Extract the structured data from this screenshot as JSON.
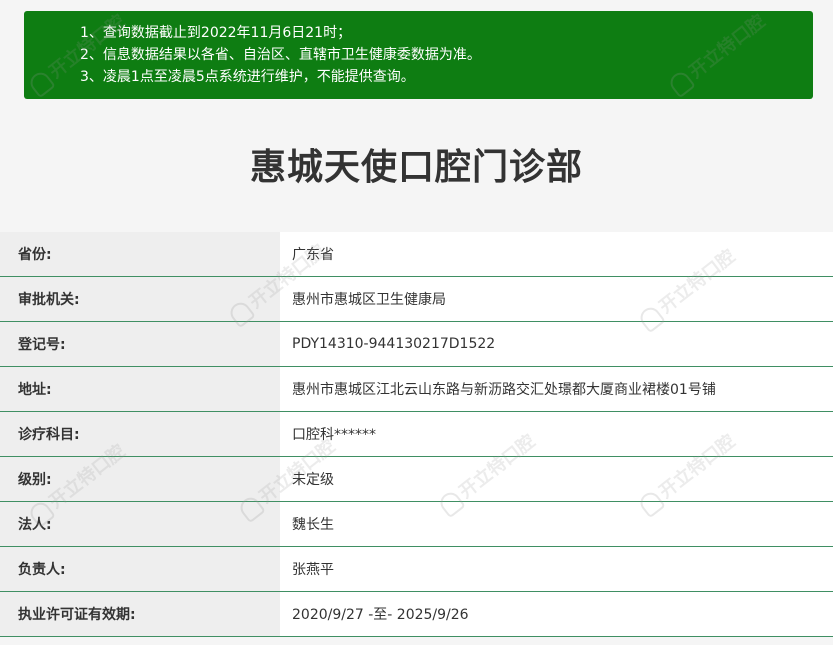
{
  "notice": {
    "items": [
      "1、查询数据截止到2022年11月6日21时；",
      "2、信息数据结果以各省、自治区、直辖市卫生健康委数据为准。",
      "3、凌晨1点至凌晨5点系统进行维护，不能提供查询。"
    ],
    "background": "#0e7d12"
  },
  "title": "惠城天使口腔门诊部",
  "rows": [
    {
      "label": "省份:",
      "value": "广东省"
    },
    {
      "label": "审批机关:",
      "value": "惠州市惠城区卫生健康局"
    },
    {
      "label": "登记号:",
      "value": "PDY14310-944130217D1522"
    },
    {
      "label": "地址:",
      "value": "惠州市惠城区江北云山东路与新沥路交汇处璟都大厦商业裙楼01号铺"
    },
    {
      "label": "诊疗科目:",
      "value": "口腔科******"
    },
    {
      "label": "级别:",
      "value": "未定级"
    },
    {
      "label": "法人:",
      "value": "魏长生"
    },
    {
      "label": "负责人:",
      "value": "张燕平"
    },
    {
      "label": "执业许可证有效期:",
      "value": "2020/9/27 -至- 2025/9/26"
    }
  ],
  "watermark": "开立特口腔",
  "colors": {
    "row_border": "#3f8f63",
    "label_bg": "#eeeeee"
  }
}
